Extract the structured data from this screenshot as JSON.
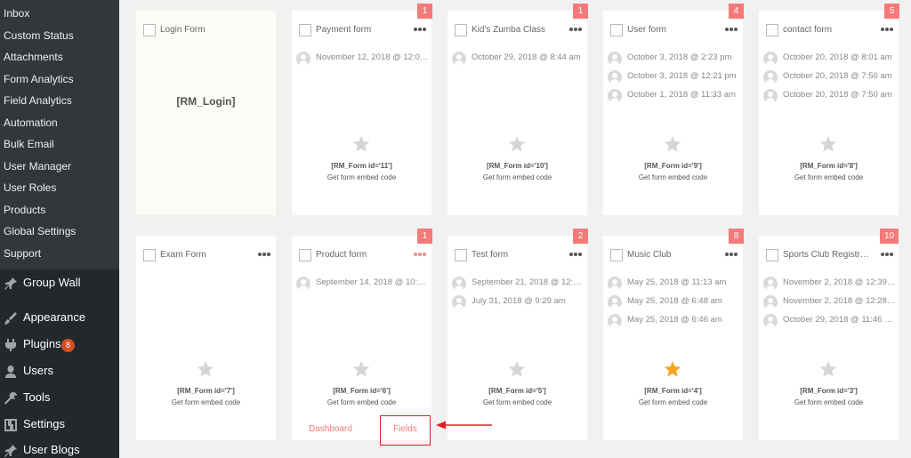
{
  "sidebar": {
    "submenu_items": [
      "Inbox",
      "Custom Status",
      "Attachments",
      "Form Analytics",
      "Field Analytics",
      "Automation",
      "Bulk Email",
      "User Manager",
      "User Roles",
      "Products",
      "Global Settings",
      "Support"
    ],
    "menu_items": [
      {
        "label": "Group Wall",
        "icon": "pin-icon"
      },
      {
        "label": "Appearance",
        "icon": "paintbrush-icon"
      },
      {
        "label": "Plugins",
        "icon": "plug-icon",
        "badge": "8"
      },
      {
        "label": "Users",
        "icon": "user-icon"
      },
      {
        "label": "Tools",
        "icon": "wrench-icon"
      },
      {
        "label": "Settings",
        "icon": "settings-icon"
      },
      {
        "label": "User Blogs",
        "icon": "pin-icon"
      }
    ]
  },
  "cards": [
    {
      "title": "Login Form",
      "login_code": "[RM_Login]"
    },
    {
      "title": "Payment form",
      "count": "1",
      "submissions": [
        "November 12, 2018 @ 12:0…"
      ],
      "shortcode": "[RM_Form id='11']",
      "embed": "Get form embed code"
    },
    {
      "title": "Kid's Zumba Class",
      "count": "1",
      "submissions": [
        "October 29, 2018 @ 8:44 am"
      ],
      "shortcode": "[RM_Form id='10']",
      "embed": "Get form embed code"
    },
    {
      "title": "User form",
      "count": "4",
      "submissions": [
        "October 3, 2018 @ 2:23 pm",
        "October 3, 2018 @ 12:21 pm",
        "October 1, 2018 @ 11:33 am"
      ],
      "shortcode": "[RM_Form id='9']",
      "embed": "Get form embed code"
    },
    {
      "title": "contact form",
      "count": "5",
      "submissions": [
        "October 20, 2018 @ 8:01 am",
        "October 20, 2018 @ 7:50 am",
        "October 20, 2018 @ 7:50 am"
      ],
      "shortcode": "[RM_Form id='8']",
      "embed": "Get form embed code"
    },
    {
      "title": "Exam Form",
      "shortcode": "[RM_Form id='7']",
      "embed": "Get form embed code"
    },
    {
      "title": "Product form",
      "count": "1",
      "submissions": [
        "September 14, 2018 @ 10:3…"
      ],
      "shortcode": "[RM_Form id='6']",
      "embed": "Get form embed code",
      "dots_active": true,
      "links": {
        "dashboard": "Dashboard",
        "fields": "Fields"
      }
    },
    {
      "title": "Test form",
      "count": "2",
      "submissions": [
        "September 21, 2018 @ 12:2…",
        "July 31, 2018 @ 9:29 am"
      ],
      "shortcode": "[RM_Form id='5']",
      "embed": "Get form embed code"
    },
    {
      "title": "Music Club",
      "count": "8",
      "submissions": [
        "May 25, 2018 @ 11:13 am",
        "May 25, 2018 @ 6:48 am",
        "May 25, 2018 @ 6:46 am"
      ],
      "shortcode": "[RM_Form id='4']",
      "embed": "Get form embed code",
      "starred": true
    },
    {
      "title": "Sports Club Registrat…",
      "count": "10",
      "submissions": [
        "November 2, 2018 @ 12:39…",
        "November 2, 2018 @ 12:28…",
        "October 29, 2018 @ 11:46 …"
      ],
      "shortcode": "[RM_Form id='3']",
      "embed": "Get form embed code"
    }
  ],
  "colors": {
    "sidebar_bg": "#23282d",
    "submenu_bg": "#32373c",
    "accent_red": "#f47a7a",
    "star_active": "#f5a623",
    "star_inactive": "#d5d5d5",
    "highlight_box": "#e02020"
  }
}
